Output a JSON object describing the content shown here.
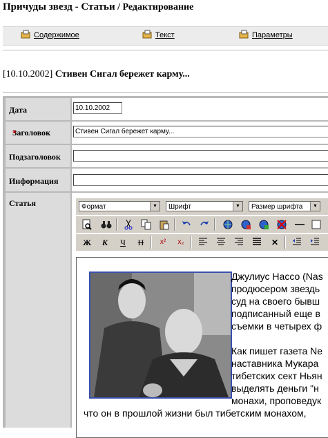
{
  "header": {
    "site": "Причуды звезд",
    "separator": " - ",
    "section": "Статьи",
    "page": " / Редактирование"
  },
  "tabs": [
    {
      "label": "Содержимое",
      "icon": "content-icon"
    },
    {
      "label": "Текст",
      "icon": "text-icon"
    },
    {
      "label": "Параметры",
      "icon": "settings-icon"
    }
  ],
  "article_heading": {
    "date": "[10.10.2002]",
    "title": "Стивен Сигал бережет карму..."
  },
  "form": {
    "date_label": "Дата",
    "date_value": "10.10.2002",
    "title_label": "Заголовок",
    "required_mark": "*",
    "title_value": "Стивен Сигал бережет карму...",
    "subtitle_label": "Подзаголовок",
    "subtitle_value": "",
    "info_label": "Информация",
    "info_value": "",
    "article_label": "Статья"
  },
  "editor": {
    "format_select": "Формат",
    "font_select": "Шрифт",
    "size_select": "Размер шрифта",
    "bold": "Ж",
    "italic": "К",
    "underline": "Ч",
    "strike": "Н",
    "superscript": "x²",
    "subscript": "x₂",
    "remove": "✕",
    "content_lines": [
      "Джулиус Нассо (Nas",
      "продюсером звездь",
      "суд на своего бывш",
      "подписанный еще в",
      "съемки в четырех ф"
    ],
    "content_lines2": [
      "Как пишет газета Ne",
      "наставника Мукара",
      "тибетских сект Ньян",
      "выделять деньги \"н",
      "монахи, проповедук"
    ],
    "content_last": "что он в прошлой жизни был тибетским монахом,"
  }
}
